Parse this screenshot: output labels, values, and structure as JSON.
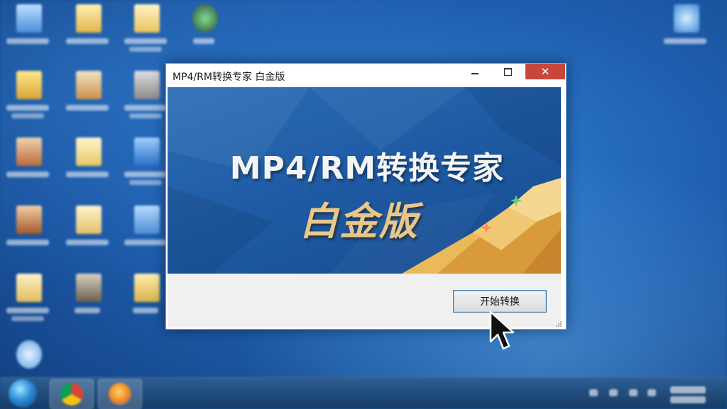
{
  "window": {
    "title": "MP4/RM转换专家 白金版",
    "minimize_glyph": "",
    "close_glyph": "✕"
  },
  "banner": {
    "title": "MP4/RM转换专家",
    "subtitle": "白金版"
  },
  "actions": {
    "start_label": "开始转换"
  },
  "colors": {
    "banner_blue": "#1e5aa3",
    "close_red": "#c7473d",
    "gold_accent": "#e8b55a",
    "button_border": "#3c7fb1"
  },
  "icons": [
    "desktop-icon",
    "chrome-icon",
    "firefox-icon",
    "start-orb-icon",
    "cursor-icon",
    "sparkle-icon"
  ]
}
